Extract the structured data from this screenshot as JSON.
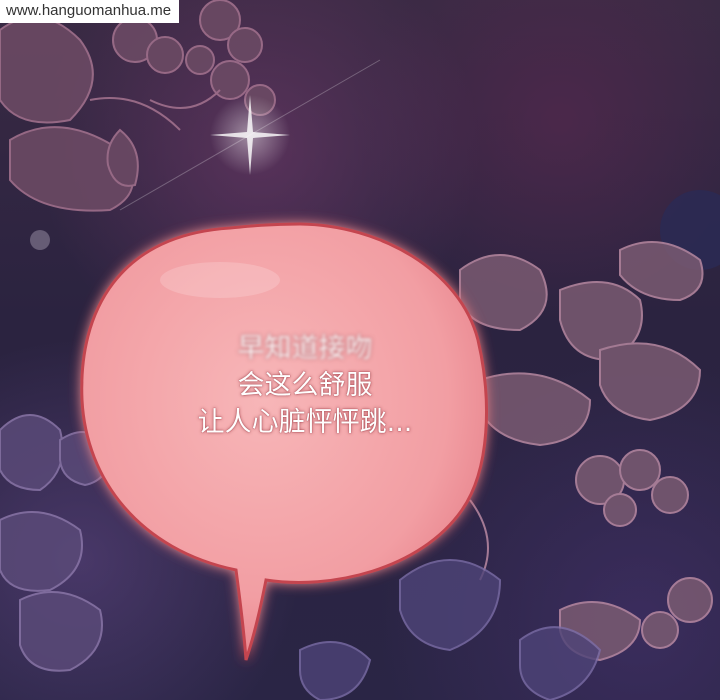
{
  "watermark": {
    "text": "www.hanguomanhua.me"
  },
  "speech_bubble": {
    "lines": [
      "早知道接吻",
      "会这么舒服",
      "让人心脏怦怦跳..."
    ]
  },
  "colors": {
    "bubble_fill": "#f4a5a8",
    "bubble_outline": "#c4454f",
    "background_dark": "#2a2545",
    "flower_outline": "#9a6a86"
  }
}
